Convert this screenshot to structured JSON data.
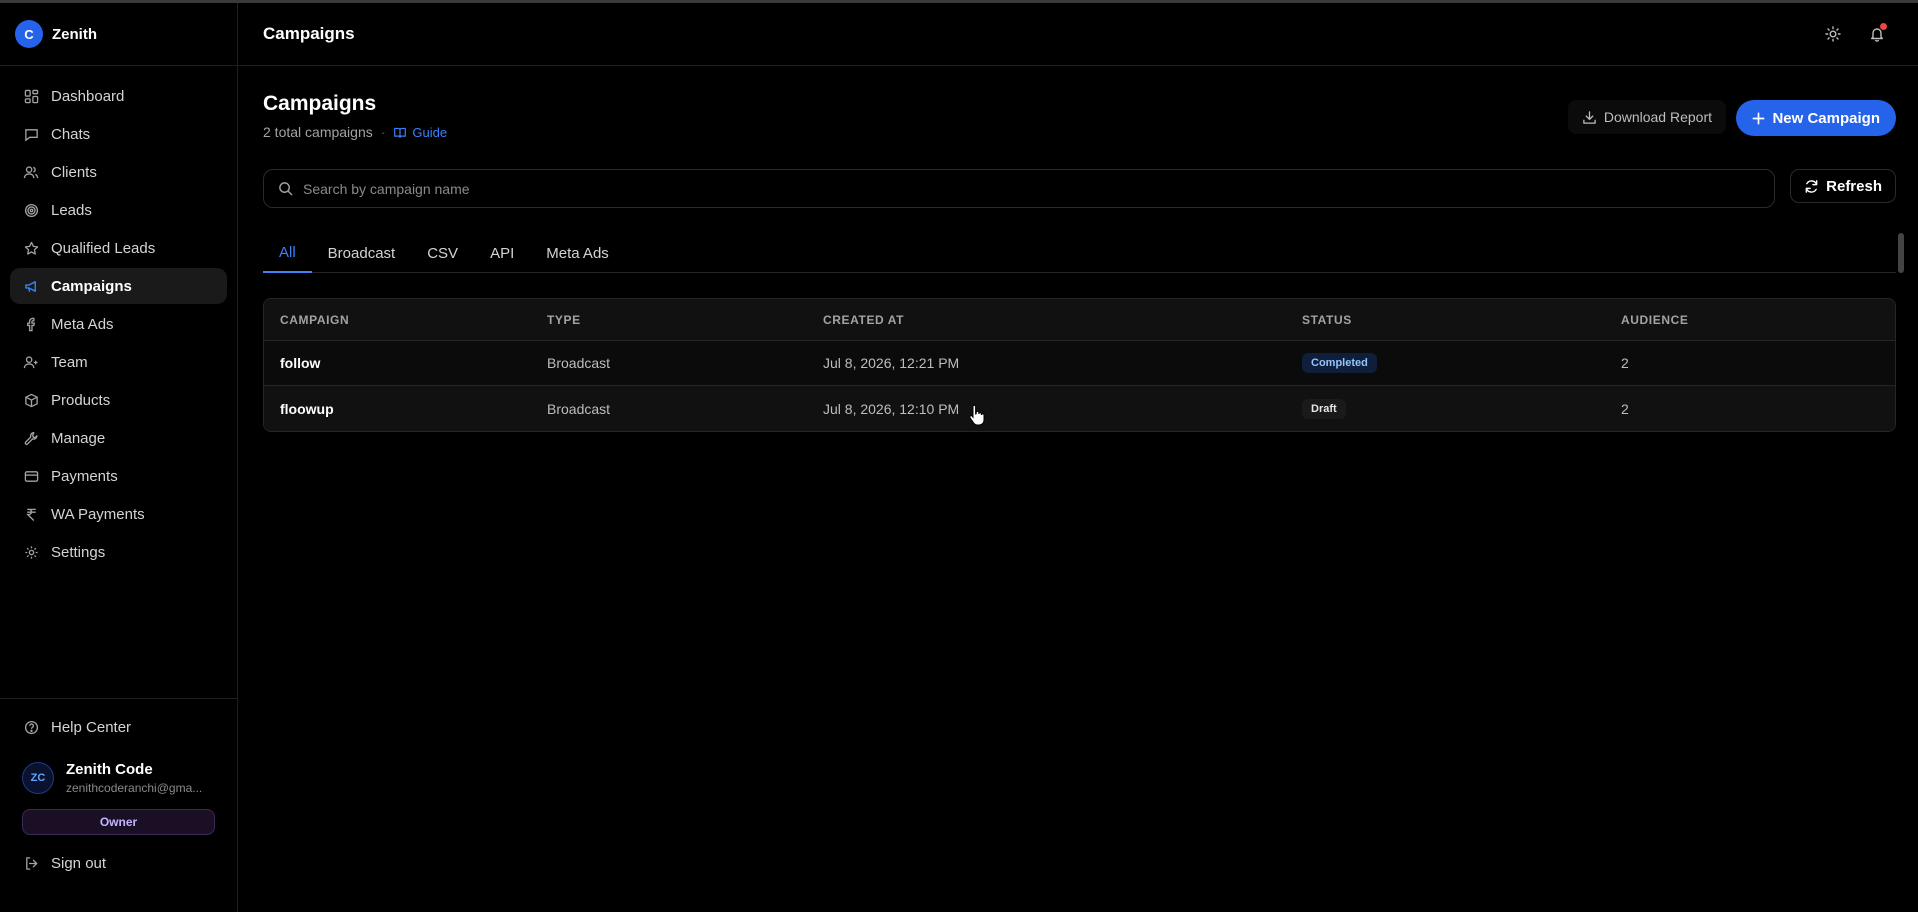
{
  "brand": {
    "initial": "C",
    "name": "Zenith"
  },
  "sidebar": {
    "items": [
      {
        "label": "Dashboard",
        "icon": "grid-icon"
      },
      {
        "label": "Chats",
        "icon": "chat-icon"
      },
      {
        "label": "Clients",
        "icon": "users-icon"
      },
      {
        "label": "Leads",
        "icon": "target-icon"
      },
      {
        "label": "Qualified Leads",
        "icon": "star-icon"
      },
      {
        "label": "Campaigns",
        "icon": "megaphone-icon",
        "active": true
      },
      {
        "label": "Meta Ads",
        "icon": "facebook-icon"
      },
      {
        "label": "Team",
        "icon": "user-plus-icon"
      },
      {
        "label": "Products",
        "icon": "package-icon"
      },
      {
        "label": "Manage",
        "icon": "wrench-icon"
      },
      {
        "label": "Payments",
        "icon": "credit-card-icon"
      },
      {
        "label": "WA Payments",
        "icon": "rupee-icon"
      },
      {
        "label": "Settings",
        "icon": "gear-icon"
      }
    ],
    "help_label": "Help Center",
    "user": {
      "initials": "ZC",
      "name": "Zenith Code",
      "email": "zenithcoderanchi@gma...",
      "role": "Owner"
    },
    "signout_label": "Sign out"
  },
  "header": {
    "title": "Campaigns"
  },
  "main": {
    "title": "Campaigns",
    "subtitle": "2 total campaigns",
    "guide_label": "Guide",
    "download_label": "Download Report",
    "new_label": "New Campaign",
    "search_placeholder": "Search by campaign name",
    "refresh_label": "Refresh",
    "tabs": [
      "All",
      "Broadcast",
      "CSV",
      "API",
      "Meta Ads"
    ],
    "active_tab": "All",
    "table": {
      "columns": [
        "CAMPAIGN",
        "TYPE",
        "CREATED AT",
        "STATUS",
        "AUDIENCE"
      ],
      "rows": [
        {
          "campaign": "follow",
          "type": "Broadcast",
          "created_at": "Jul 8, 2026, 12:21 PM",
          "status": "Completed",
          "audience": "2"
        },
        {
          "campaign": "floowup",
          "type": "Broadcast",
          "created_at": "Jul 8, 2026, 12:10 PM",
          "status": "Draft",
          "audience": "2"
        }
      ]
    }
  },
  "colors": {
    "accent": "#2563eb",
    "background": "#000000",
    "notification": "#ef4444"
  }
}
